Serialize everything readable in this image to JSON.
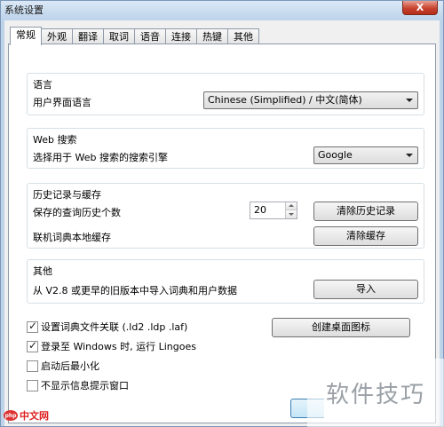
{
  "window": {
    "title": "系统设置",
    "close_glyph": "X"
  },
  "tabs": [
    {
      "label": "常规"
    },
    {
      "label": "外观"
    },
    {
      "label": "翻译"
    },
    {
      "label": "取词"
    },
    {
      "label": "语音"
    },
    {
      "label": "连接"
    },
    {
      "label": "热键"
    },
    {
      "label": "其他"
    }
  ],
  "language": {
    "title": "语言",
    "ui_label": "用户界面语言",
    "ui_value": "Chinese (Simplified)  /  中文(简体)"
  },
  "web_search": {
    "title": "Web 搜索",
    "label": "选择用于 Web 搜索的搜索引擎",
    "value": "Google"
  },
  "history": {
    "title": "历史记录与缓存",
    "count_label": "保存的查询历史个数",
    "count_value": "20",
    "clear_history": "清除历史记录",
    "cache_label": "联机词典本地缓存",
    "clear_cache": "清除缓存"
  },
  "other": {
    "title": "其他",
    "import_label": "从 V2.8 或更早的旧版本中导入词典和用户数据",
    "import_button": "导入"
  },
  "options": [
    {
      "label": "设置词典文件关联 (.ld2 .ldp .laf)",
      "checked": true
    },
    {
      "label": "登录至 Windows 时, 运行 Lingoes",
      "checked": true
    },
    {
      "label": "启动后最小化",
      "checked": false
    },
    {
      "label": "不显示信息提示窗口",
      "checked": false
    }
  ],
  "desktop_icon_button": "创建桌面图标",
  "watermark": {
    "left": "中文网",
    "left_badge": "php",
    "right": "软件技巧"
  }
}
